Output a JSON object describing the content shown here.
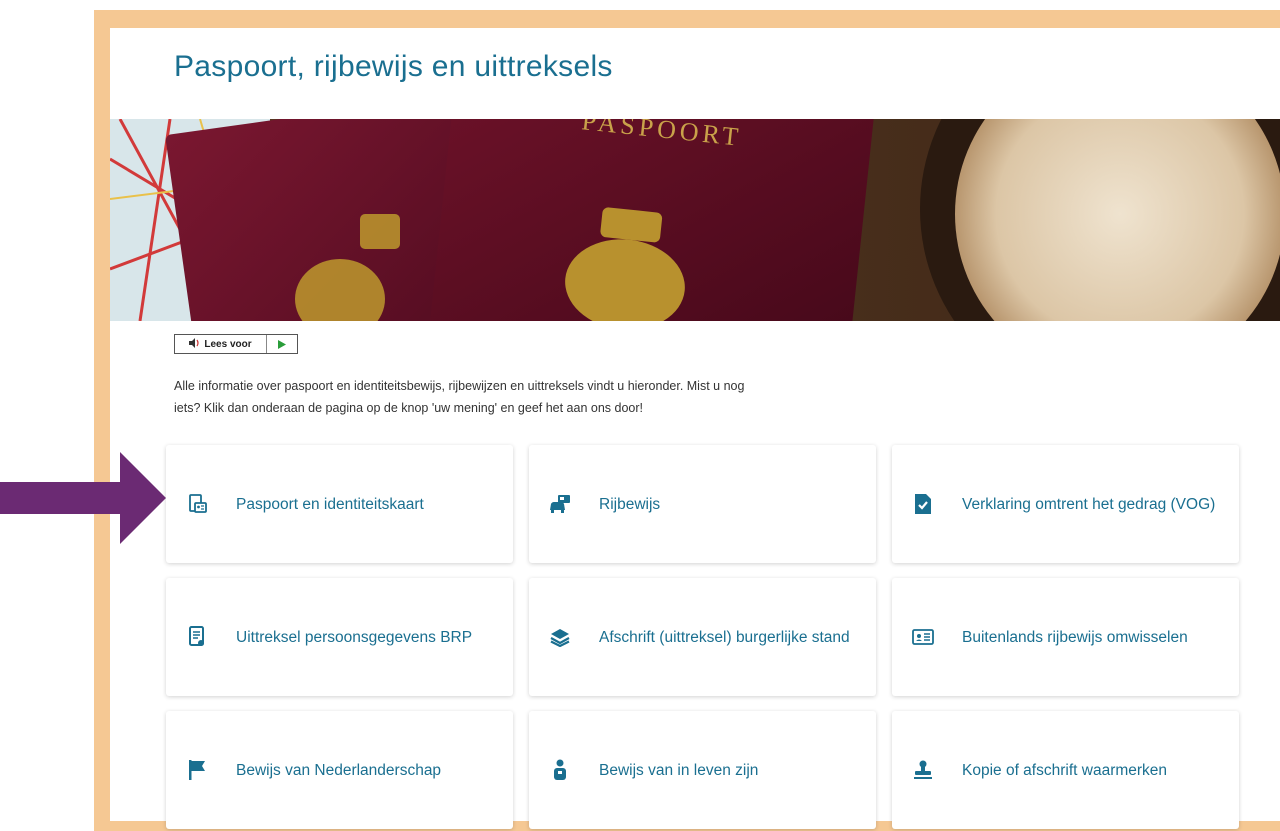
{
  "page": {
    "title": "Paspoort, rijbewijs en uittreksels",
    "hero_text": "PASPOORT",
    "readspeaker": {
      "label": "Lees voor"
    },
    "intro_line1": "Alle informatie over paspoort en identiteitsbewijs, rijbewijzen en uittreksels vindt u hieronder. Mist u nog",
    "intro_line2": "iets? Klik dan onderaan de pagina op de knop 'uw mening' en geef het aan ons door!"
  },
  "cards": [
    {
      "label": "Paspoort en identiteitskaart",
      "icon": "id-card-icon"
    },
    {
      "label": "Rijbewijs",
      "icon": "car-license-icon"
    },
    {
      "label": "Verklaring omtrent het gedrag (VOG)",
      "icon": "document-check-icon"
    },
    {
      "label": "Uittreksel persoonsgegevens BRP",
      "icon": "document-person-icon"
    },
    {
      "label": "Afschrift (uittreksel) burgerlijke stand",
      "icon": "layers-icon"
    },
    {
      "label": "Buitenlands rijbewijs omwisselen",
      "icon": "license-card-icon"
    },
    {
      "label": "Bewijs van Nederlanderschap",
      "icon": "flag-icon"
    },
    {
      "label": "Bewijs van in leven zijn",
      "icon": "person-icon"
    },
    {
      "label": "Kopie of afschrift waarmerken",
      "icon": "stamp-icon"
    }
  ],
  "colors": {
    "accent": "#1a6f90",
    "frame": "#f5c893",
    "arrow": "#6b2a73"
  }
}
